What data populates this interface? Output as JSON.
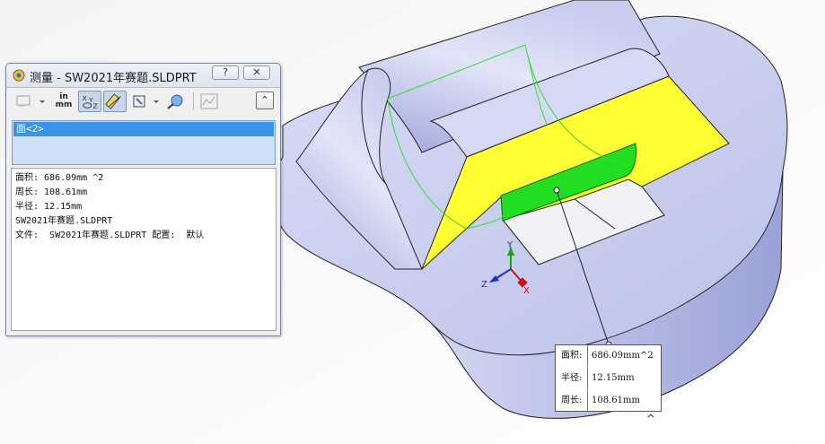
{
  "dialog": {
    "title": "测量 - SW2021年赛题.SLDPRT",
    "help_label": "?",
    "close_label": "✕",
    "toolbar": {
      "units_label_top": "in",
      "units_label_bottom": "mm",
      "collapse_label": "⌃"
    },
    "selection": {
      "item": "面<2>"
    },
    "results": [
      "面积: 686.09mm ^2",
      "周长: 108.61mm",
      "半径: 12.15mm",
      "SW2021年赛题.SLDPRT",
      "文件:  SW2021年赛题.SLDPRT 配置:  默认"
    ]
  },
  "callout": {
    "rows": [
      {
        "label": "面积:",
        "value": "686.09mm^2"
      },
      {
        "label": "半径:",
        "value": "12.15mm"
      },
      {
        "label": "周长:",
        "value": "108.61mm"
      }
    ],
    "collapse_label": "^"
  },
  "triad": {
    "x_label": "X",
    "y_label": "Y",
    "z_label": "Z"
  },
  "colors": {
    "model_face": "#c9cef0",
    "model_shade": "#a9b0df",
    "selected_face": "#ffff33",
    "highlighted_face": "#22dd22",
    "selection_highlight": "#3b93e8"
  },
  "icons": [
    "measure-icon",
    "hide-icon",
    "units-icon",
    "xyz-icon",
    "dimension-icon",
    "projection-icon",
    "point-icon",
    "history-icon"
  ]
}
